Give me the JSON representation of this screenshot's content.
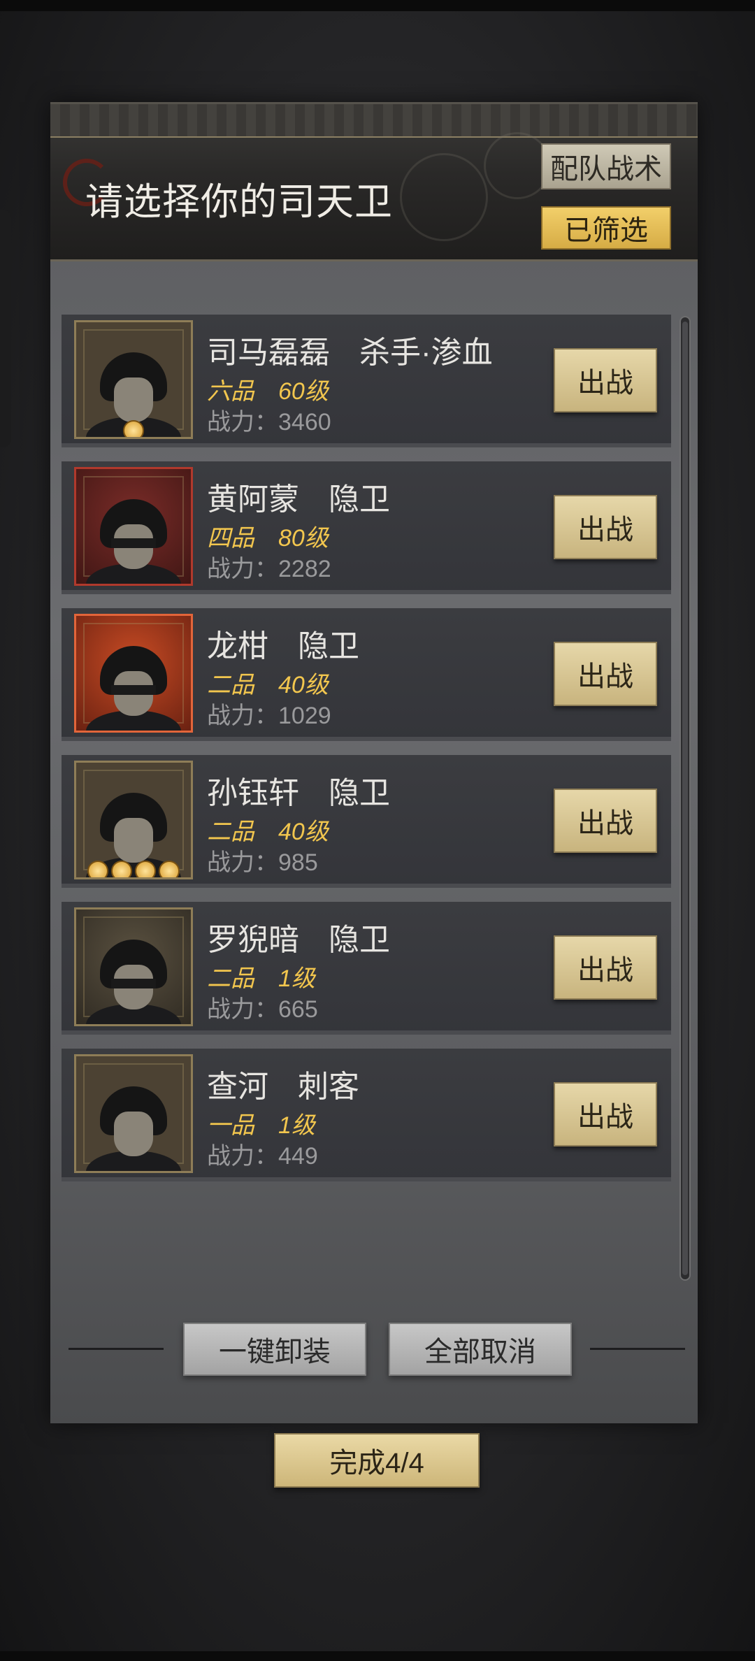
{
  "header": {
    "title": "请选择你的司天卫",
    "tactics_button": "配队战术",
    "filter_button": "已筛选"
  },
  "heroes": [
    {
      "name": "司马磊磊",
      "class": "杀手·渗血",
      "rank": "六品",
      "level": "60级",
      "power": "战力：3460",
      "frame": "gold",
      "medals": 1,
      "action": "出战"
    },
    {
      "name": "黄阿蒙",
      "class": "隐卫",
      "rank": "四品",
      "level": "80级",
      "power": "战力：2282",
      "frame": "red",
      "medals": 0,
      "action": "出战"
    },
    {
      "name": "龙柑",
      "class": "隐卫",
      "rank": "二品",
      "level": "40级",
      "power": "战力：1029",
      "frame": "orange",
      "medals": 0,
      "action": "出战"
    },
    {
      "name": "孙钰轩",
      "class": "隐卫",
      "rank": "二品",
      "level": "40级",
      "power": "战力：985",
      "frame": "gold",
      "medals": 4,
      "action": "出战"
    },
    {
      "name": "罗猊暗",
      "class": "隐卫",
      "rank": "二品",
      "level": "1级",
      "power": "战力：665",
      "frame": "gold",
      "medals": 0,
      "action": "出战"
    },
    {
      "name": "查河",
      "class": "刺客",
      "rank": "一品",
      "level": "1级",
      "power": "战力：449",
      "frame": "gold",
      "medals": 0,
      "action": "出战"
    }
  ],
  "footer": {
    "unequip_all": "一键卸装",
    "cancel_all": "全部取消",
    "done": "完成4/4"
  },
  "colors": {
    "rank_gold": "#f2c64e",
    "filter_button_bg": "#e7c15d",
    "card_bg": "#38393d"
  }
}
